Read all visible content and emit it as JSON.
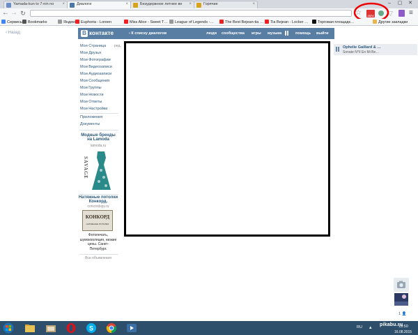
{
  "browser": {
    "tabs": [
      {
        "label": "Yamada-kun to 7-nin no",
        "favicon_color": "#6a8fc8"
      },
      {
        "label": "Диалоги",
        "favicon_color": "#4a76a8"
      },
      {
        "label": "Безудержное летнее ве",
        "favicon_color": "#d9a21b"
      },
      {
        "label": "Горячие",
        "favicon_color": "#d9a21b"
      }
    ],
    "window_controls": [
      "–",
      "▢",
      "✕"
    ],
    "bookmarks": [
      {
        "label": "Сервисы",
        "icon": "apps-grid-icon",
        "color": "#4285f4"
      },
      {
        "label": "Bookmarks",
        "icon": "star-icon",
        "color": "#555"
      },
      {
        "label": "Яндекс",
        "icon": "page-icon",
        "color": "#999"
      },
      {
        "label": "Euphoria - Loreen",
        "icon": "video-icon",
        "color": "#e22"
      },
      {
        "label": "Miss Alice - Sweet T…",
        "icon": "video-icon",
        "color": "#e22"
      },
      {
        "label": "League of Legends -…",
        "icon": "page-icon",
        "color": "#999"
      },
      {
        "label": "The Best Bejean-tia …",
        "icon": "video-icon",
        "color": "#e22"
      },
      {
        "label": "Tia Bejean - Locker …",
        "icon": "video-icon",
        "color": "#e22"
      },
      {
        "label": "Торговая площадк…",
        "icon": "page-icon",
        "color": "#111"
      },
      {
        "label": "Другие закладки",
        "icon": "folder-icon",
        "color": "#e8b64c"
      }
    ],
    "extension_badge": "2374"
  },
  "vk": {
    "back_top": "Назад",
    "logo_text": "контакте",
    "back_to_dialogs": "К списку диалогов",
    "nav": [
      "люди",
      "сообщества",
      "игры",
      "музыка",
      "помощь",
      "выйти"
    ],
    "edit": "ред.",
    "menu": [
      "Моя Страница",
      "Мои Друзья",
      "Мои Фотографии",
      "Мои Видеозаписи",
      "Мои Аудиозаписи",
      "Мои Сообщения",
      "Мои Группы",
      "Мои Новости",
      "Мои Ответы",
      "Мои Настройки"
    ],
    "menu2": [
      "Приложения",
      "Документы"
    ],
    "ad1": {
      "title": "Модные бренды на Lamoda",
      "domain": "lamoda.ru",
      "brand": "SAVAGE"
    },
    "ad2": {
      "title": "Натяжные потолки Конкорд.",
      "domain": "concordspy.ru",
      "logo": "КОНКОРД",
      "logo_sub": "НАТЯЖНЫЕ ПОТОЛКИ",
      "text": "Фотопечать, шумоизоляция, низкие цены. Санкт-Петербург."
    },
    "all_ads": "Все объявления",
    "player": {
      "title": "Ophelie Gaillard & …",
      "subtitle": "Sonate N°II En Mi Be…"
    },
    "chat_count": "1"
  },
  "taskbar": {
    "lang": "RU",
    "time": "19:50",
    "date": "16.08.2015",
    "watermark": "pikabu.ru"
  }
}
